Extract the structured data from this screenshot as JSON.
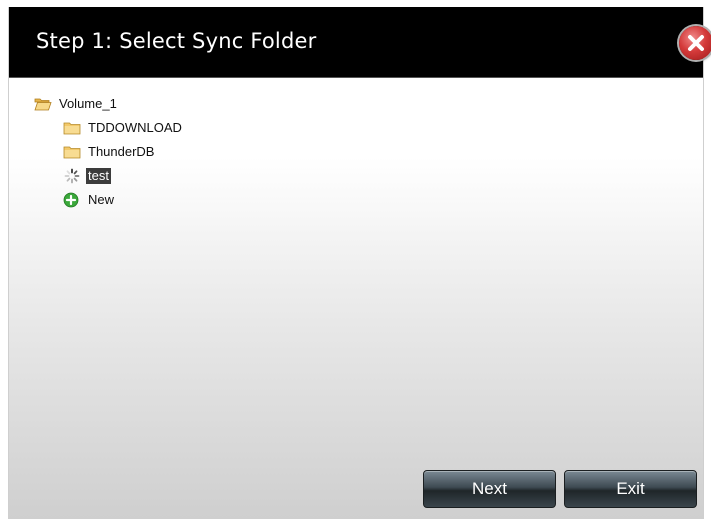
{
  "dialog": {
    "title": "Step 1: Select Sync Folder",
    "close_icon": "close-icon"
  },
  "tree": {
    "root": {
      "label": "Volume_1",
      "icon": "folder-open-icon"
    },
    "children": [
      {
        "label": "TDDOWNLOAD",
        "icon": "folder-icon"
      },
      {
        "label": "ThunderDB",
        "icon": "folder-icon"
      },
      {
        "label": "test",
        "icon": "loading-spinner-icon",
        "selected": true
      },
      {
        "label": "New",
        "icon": "add-circle-icon"
      }
    ]
  },
  "buttons": {
    "next_label": "Next",
    "exit_label": "Exit"
  },
  "colors": {
    "titlebar": "#000000",
    "selection": "#3c3c3c",
    "close": "#d43a3a",
    "add": "#3aa83a",
    "folder": "#f3c96a"
  }
}
